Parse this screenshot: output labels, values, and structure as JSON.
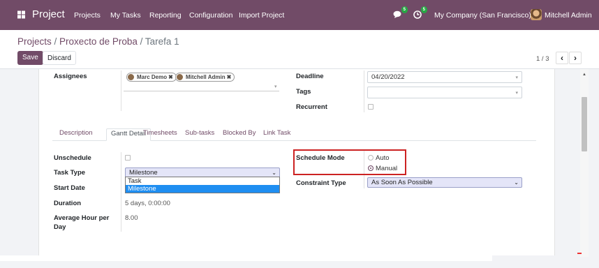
{
  "navbar": {
    "brand": "Project",
    "menu": [
      "Projects",
      "My Tasks",
      "Reporting",
      "Configuration",
      "Import Project"
    ],
    "messages_count": "5",
    "activities_count": "5",
    "company": "My Company (San Francisco)",
    "user": "Mitchell Admin"
  },
  "breadcrumb": {
    "projects": "Projects",
    "sep1": " / ",
    "project": "Proxecto de Proba",
    "sep2": " / ",
    "task": "Tarefa 1"
  },
  "buttons": {
    "save": "Save",
    "discard": "Discard"
  },
  "pager": {
    "value": "1 / 3",
    "prev": "‹",
    "next": "›"
  },
  "form": {
    "assignees_label": "Assignees",
    "assignees": [
      "Marc Demo",
      "Mitchell Admin"
    ],
    "deadline_label": "Deadline",
    "deadline_value": "04/20/2022",
    "tags_label": "Tags",
    "recurrent_label": "Recurrent"
  },
  "tabs": [
    "Description",
    "Gantt Detail",
    "Timesheets",
    "Sub-tasks",
    "Blocked By",
    "Link Task"
  ],
  "gantt": {
    "unschedule_label": "Unschedule",
    "task_type_label": "Task Type",
    "task_type_value": "Milestone",
    "task_type_options": [
      "Task",
      "Milestone"
    ],
    "start_date_label": "Start Date",
    "duration_label": "Duration",
    "duration_value": "5 days, 0:00:00",
    "avg_hour_label_1": "Average Hour per",
    "avg_hour_label_2": "Day",
    "avg_hour_value": "8.00",
    "schedule_mode_label": "Schedule Mode",
    "schedule_mode_options": [
      "Auto",
      "Manual"
    ],
    "schedule_mode_selected": "Manual",
    "constraint_type_label": "Constraint Type",
    "constraint_type_value": "As Soon As Possible"
  },
  "colors": {
    "brand": "#714b67",
    "select_bg": "#e4e5f8",
    "highlight": "#cc2222",
    "option_selected": "#1f8ef1"
  }
}
